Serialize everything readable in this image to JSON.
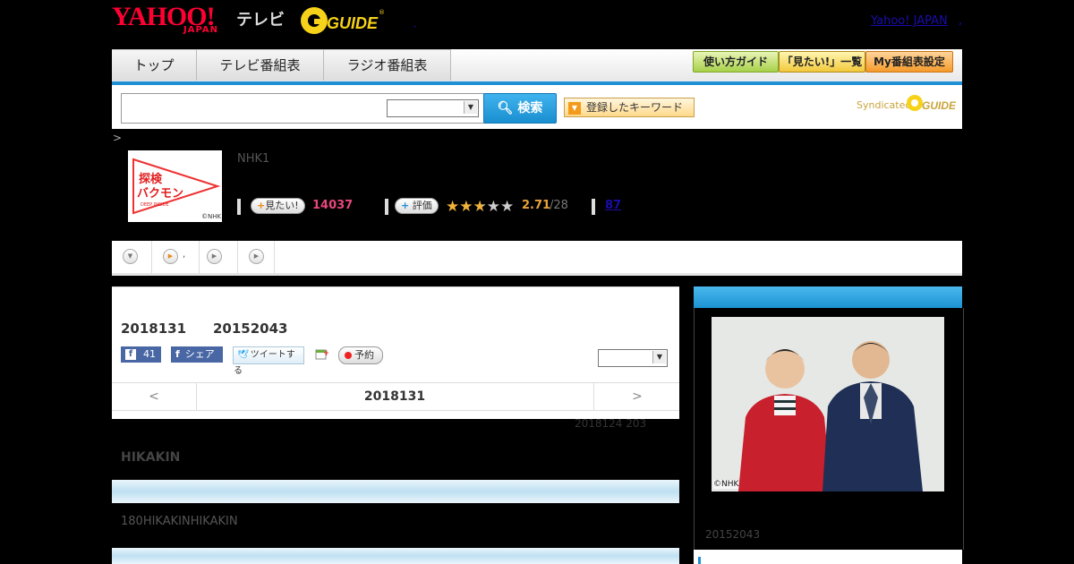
{
  "header": {
    "logo_main": "YAHOO!",
    "logo_sub": "JAPAN",
    "logo_tv": "テレビ",
    "gguide_logo": "G GUIDE",
    "separator": ",",
    "top_link": "Yahoo! JAPAN",
    "top_dot": ","
  },
  "nav": {
    "tabs": [
      "トップ",
      "テレビ番組表",
      "ラジオ番組表"
    ],
    "buttons": [
      "使い方ガイド",
      "「見たい!」一覧",
      "My番組表設定"
    ]
  },
  "search": {
    "placeholder": "",
    "button_label": "検索",
    "keyword_button": "登録したキーワード",
    "syndicated": "Syndicated",
    "syndicated_logo": "G GUIDE"
  },
  "program": {
    "breadcrumb": ">",
    "channel": "NHK1",
    "logo_text": "探検 バクモン",
    "logo_small": "DEEP INSIDE",
    "logo_copyright": "©NHK",
    "mitai_label": "見たい!",
    "mitai_count": "14037",
    "rate_label": "評価",
    "rating_value": "2.71",
    "rating_denominator": "/28",
    "rating_stars": 2.71,
    "reviews": "87"
  },
  "tabs_row": {
    "second_tab_text": ","
  },
  "detail": {
    "date": "2018131",
    "id": "20152043",
    "fb_like_count": "41",
    "fb_share": "シェア",
    "tweet": "ツイートする",
    "reserve": "予約",
    "day_prev": "<",
    "day_current": "2018131",
    "day_next": ">",
    "prev_air": "2018124  203",
    "performer": "HIKAKIN",
    "description": "180HIKAKINHIKAKIN"
  },
  "sidebar": {
    "photo_copyright": "©NHK",
    "id": "20152043"
  },
  "colors": {
    "accent_blue": "#1e90d6",
    "yahoo_red": "#ff0033",
    "pink_count": "#e8467c",
    "rating_orange": "#e8a33a"
  }
}
